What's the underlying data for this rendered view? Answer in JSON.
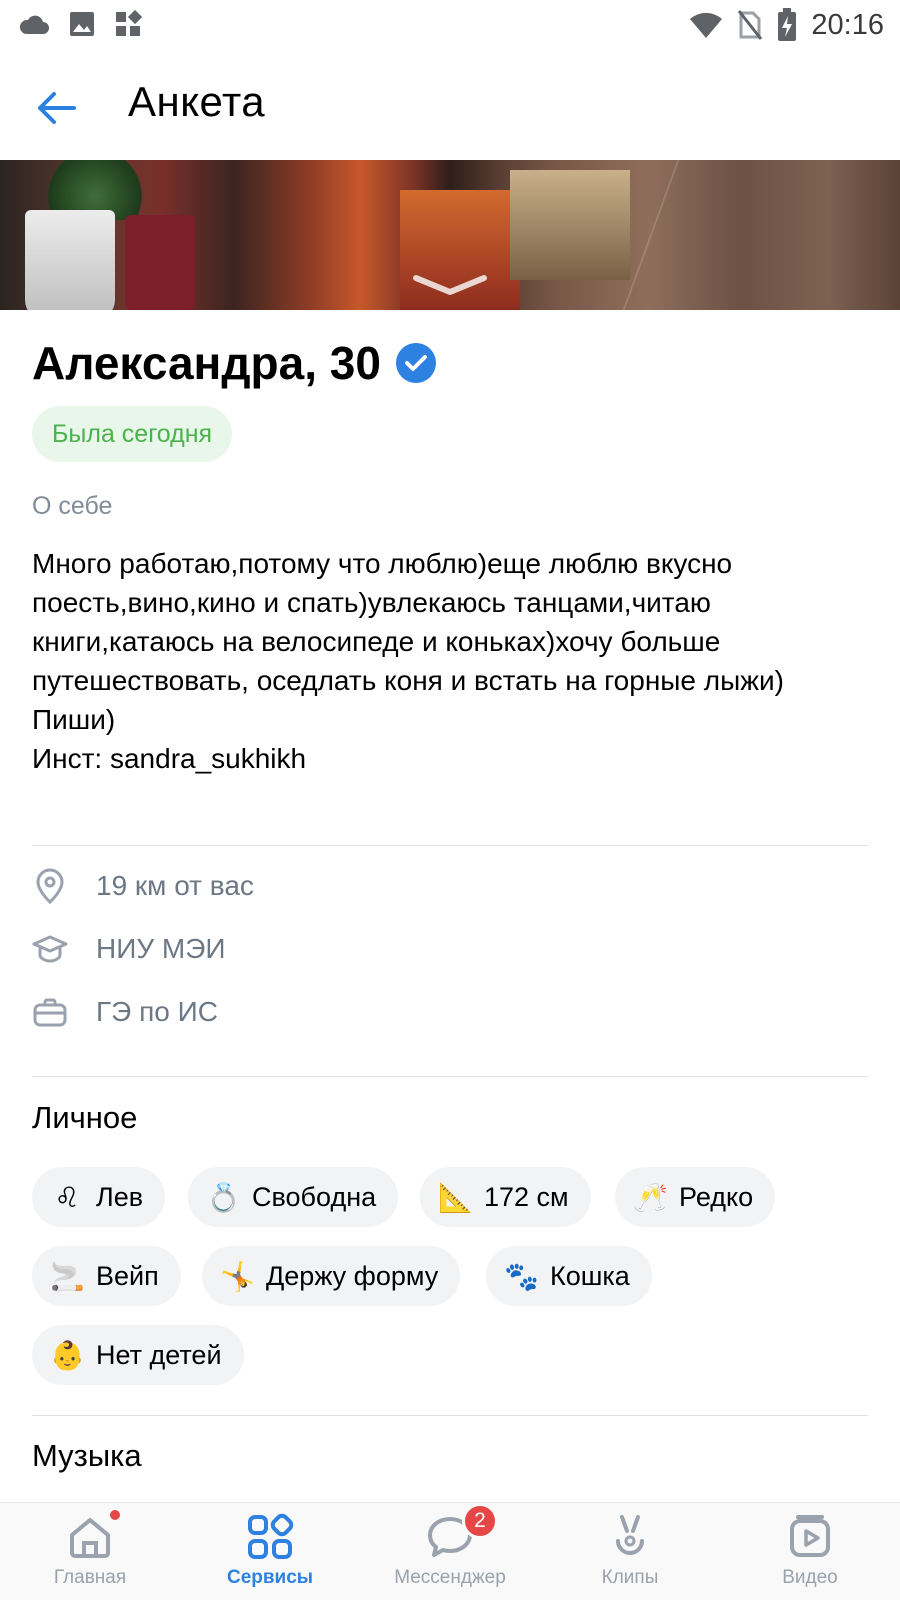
{
  "status_bar": {
    "time": "20:16",
    "left_icons": [
      "cloud-icon",
      "image-icon",
      "apps-icon"
    ],
    "right_icons": [
      "wifi-icon",
      "no-sim-icon",
      "battery-charging-icon"
    ]
  },
  "header": {
    "title": "Анкета",
    "back_icon": "arrow-left-icon"
  },
  "profile": {
    "name_age": "Александра, 30",
    "verified": true,
    "online_status": "Была сегодня",
    "about_caption": "О себе",
    "about_text": "Много работаю,потому что люблю)еще люблю вкусно поесть,вино,кино и спать)увлекаюсь танцами,читаю книги,катаюсь на велосипеде и коньках)хочу больше путешествовать, оседлать коня и встать на горные лыжи)\nПиши)\nИнст: sandra_sukhikh",
    "info": [
      {
        "icon": "location-pin-icon",
        "text": "19 км от вас"
      },
      {
        "icon": "graduation-cap-icon",
        "text": "НИУ МЭИ"
      },
      {
        "icon": "briefcase-icon",
        "text": "ГЭ по ИС"
      }
    ]
  },
  "personal": {
    "title": "Личное",
    "chips": [
      {
        "emoji": "♌",
        "label": "Лев"
      },
      {
        "emoji": "💍",
        "label": "Свободна"
      },
      {
        "emoji": "📐",
        "label": "172 см"
      },
      {
        "emoji": "🥂",
        "label": "Редко"
      },
      {
        "emoji": "🚬",
        "label": "Вейп"
      },
      {
        "emoji": "🤸",
        "label": "Держу форму"
      },
      {
        "emoji": "🐾",
        "label": "Кошка"
      },
      {
        "emoji": "👶",
        "label": "Нет детей"
      }
    ]
  },
  "music": {
    "title": "Музыка"
  },
  "tabbar": {
    "tabs": [
      {
        "label": "Главная",
        "icon": "home-icon"
      },
      {
        "label": "Сервисы",
        "icon": "services-icon"
      },
      {
        "label": "Мессенджер",
        "icon": "message-icon",
        "badge": "2"
      },
      {
        "label": "Клипы",
        "icon": "clips-icon"
      },
      {
        "label": "Видео",
        "icon": "video-icon"
      }
    ],
    "active": "Сервисы"
  },
  "colors": {
    "accent": "#2d81e0",
    "online_green": "#4bb34b",
    "secondary_text": "#818c99",
    "badge_red": "#e64646"
  }
}
